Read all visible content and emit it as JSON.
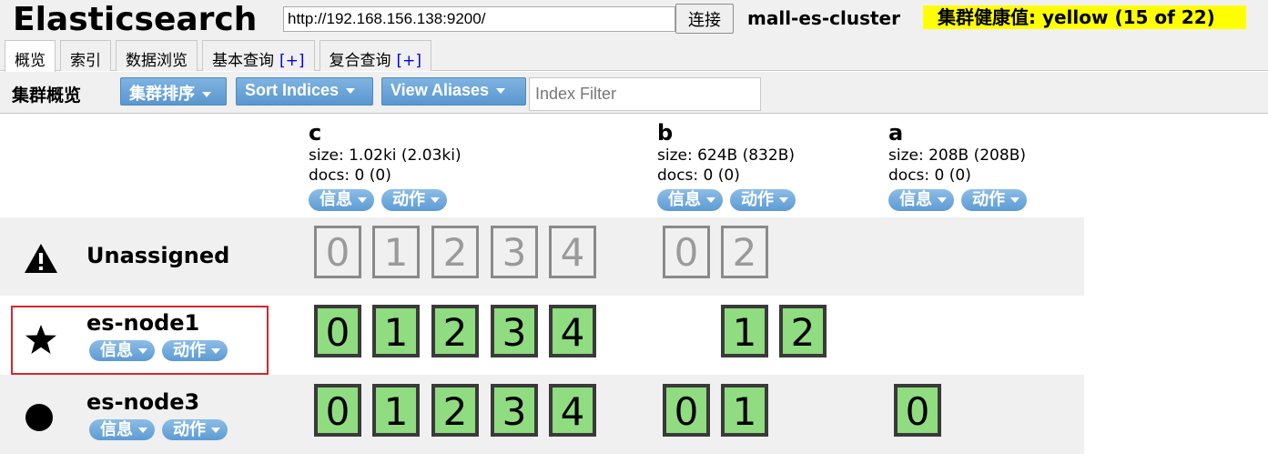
{
  "app": {
    "title": "Elasticsearch",
    "url": "http://192.168.156.138:9200/",
    "connect_label": "连接",
    "cluster_name": "mall-es-cluster",
    "health_label": "集群健康值: yellow (15 of 22)",
    "health_color": "#ffff00"
  },
  "tabs": [
    {
      "label": "概览",
      "plus": ""
    },
    {
      "label": "索引",
      "plus": ""
    },
    {
      "label": "数据浏览",
      "plus": ""
    },
    {
      "label": "基本查询",
      "plus": "[+]"
    },
    {
      "label": "复合查询",
      "plus": "[+]"
    }
  ],
  "toolbar": {
    "title": "集群概览",
    "sort_cluster_label": "集群排序",
    "sort_indices_label": "Sort Indices",
    "view_aliases_label": "View Aliases",
    "index_filter_placeholder": "Index Filter"
  },
  "indices": [
    {
      "name": "c",
      "size": "size: 1.02ki (2.03ki)",
      "docs": "docs: 0 (0)",
      "info_label": "信息",
      "action_label": "动作"
    },
    {
      "name": "b",
      "size": "size: 624B (832B)",
      "docs": "docs: 0 (0)",
      "info_label": "信息",
      "action_label": "动作"
    },
    {
      "name": "a",
      "size": "size: 208B (208B)",
      "docs": "docs: 0 (0)",
      "info_label": "信息",
      "action_label": "动作"
    }
  ],
  "rows": [
    {
      "name": "Unassigned",
      "icon": "warning-icon",
      "info_label": "",
      "action_label": "",
      "shards": {
        "c": [
          "0",
          "1",
          "2",
          "3",
          "4"
        ],
        "b": [
          "0",
          "2"
        ],
        "a": []
      }
    },
    {
      "name": "es-node1",
      "icon": "star-icon",
      "info_label": "信息",
      "action_label": "动作",
      "shards": {
        "c": [
          "0",
          "1",
          "2",
          "3",
          "4"
        ],
        "b": [
          "1",
          "2"
        ],
        "a": []
      }
    },
    {
      "name": "es-node3",
      "icon": "circle-icon",
      "info_label": "信息",
      "action_label": "动作",
      "shards": {
        "c": [
          "0",
          "1",
          "2",
          "3",
          "4"
        ],
        "b": [
          "0",
          "1"
        ],
        "a": [
          "0"
        ]
      }
    }
  ],
  "colors": {
    "shard_fill": "#90dc80",
    "button_blue": "#5a97d0",
    "highlight_border": "#d9262b"
  }
}
